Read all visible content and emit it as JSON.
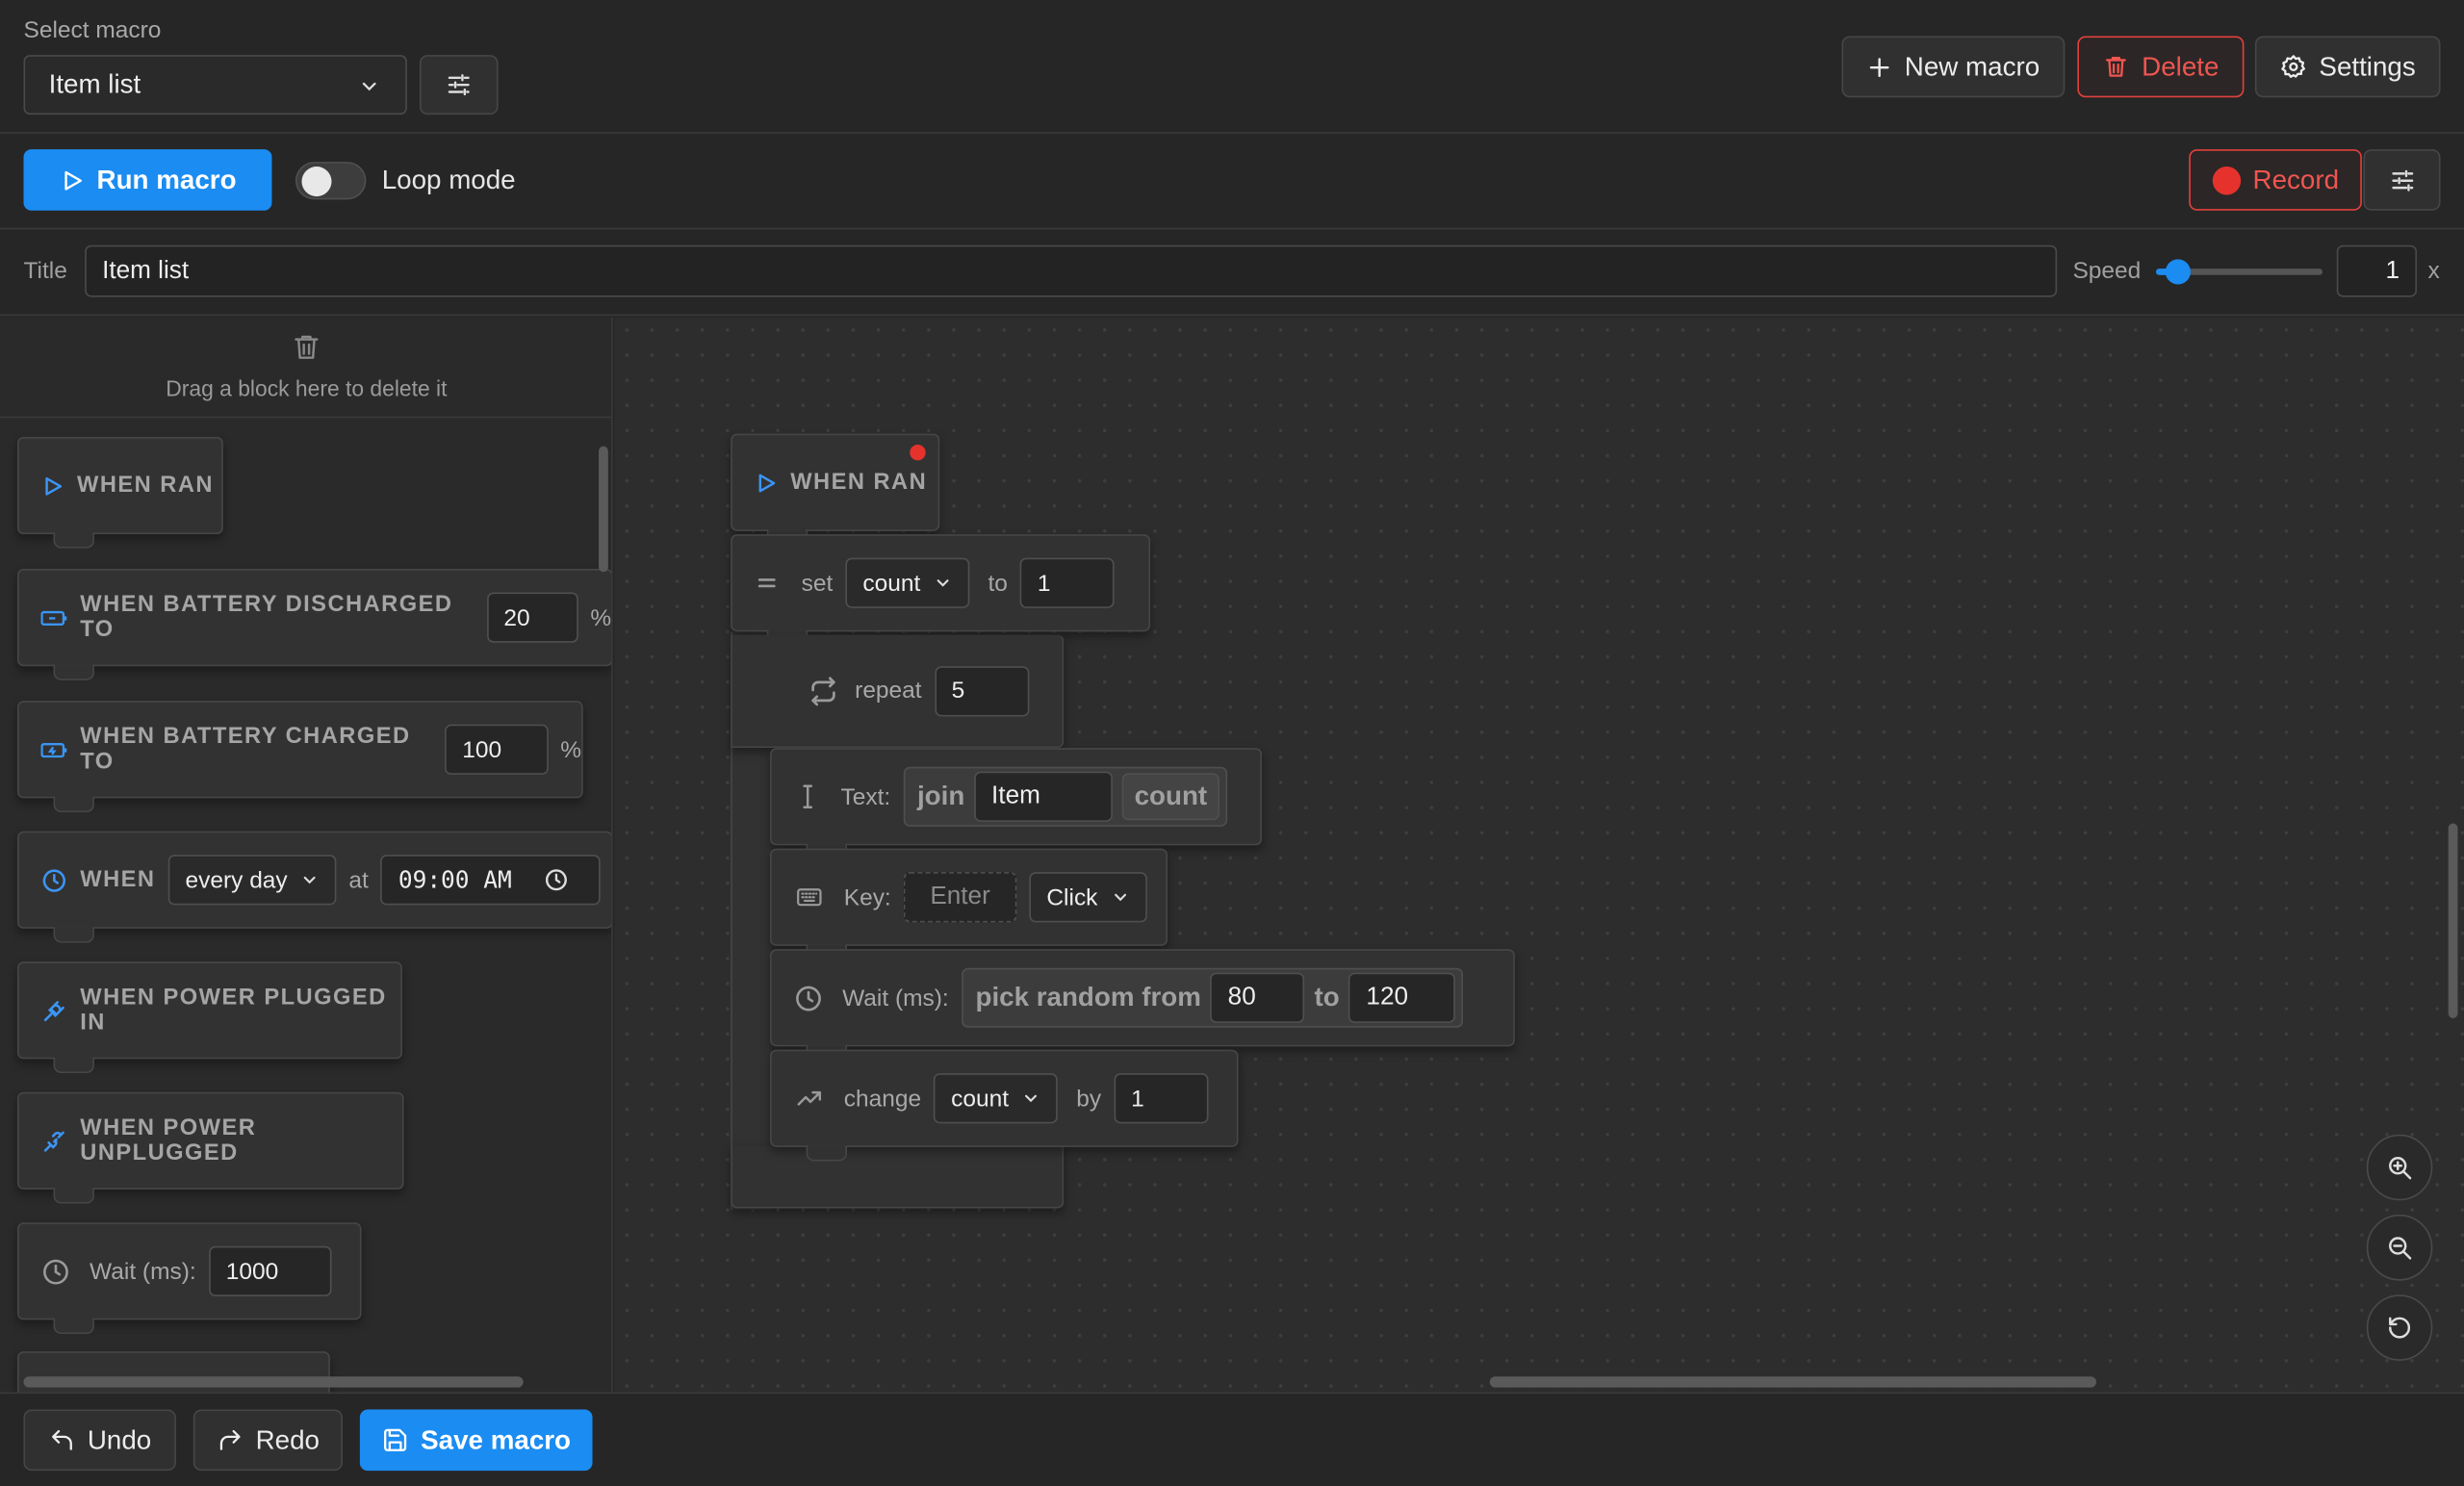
{
  "header": {
    "select_label": "Select macro",
    "selected_macro": "Item list",
    "new_macro": "New macro",
    "delete": "Delete",
    "settings": "Settings"
  },
  "toolbar": {
    "run": "Run macro",
    "loop_mode": "Loop mode",
    "loop_enabled": false,
    "record": "Record"
  },
  "titlebar": {
    "title_label": "Title",
    "title_value": "Item list",
    "speed_label": "Speed",
    "speed_value": "1",
    "speed_unit": "x",
    "speed_slider_fraction": 0.1
  },
  "sidebar": {
    "trash_hint": "Drag a block here to delete it",
    "blocks": {
      "when_ran": "WHEN RAN",
      "battery_discharged": "WHEN BATTERY DISCHARGED TO",
      "battery_discharged_value": "20",
      "battery_charged": "WHEN BATTERY CHARGED TO",
      "battery_charged_value": "100",
      "percent": "%",
      "when": "WHEN",
      "when_schedule": "every day",
      "at": "at",
      "time": "09:00 AM",
      "power_plugged": "WHEN POWER PLUGGED IN",
      "power_unplugged": "WHEN POWER UNPLUGGED",
      "wait_label": "Wait (ms):",
      "wait_value": "1000"
    }
  },
  "workspace": {
    "when_ran": "WHEN RAN",
    "set": "set",
    "set_var": "count",
    "to": "to",
    "set_value": "1",
    "repeat": "repeat",
    "repeat_value": "5",
    "text_label": "Text:",
    "join": "join",
    "join_item": "Item",
    "join_var": "count",
    "key_label": "Key:",
    "key_placeholder": "Enter",
    "key_action": "Click",
    "wait_label": "Wait (ms):",
    "pick_random": "pick random from",
    "random_from": "80",
    "random_to_label": "to",
    "random_to": "120",
    "change": "change",
    "change_var": "count",
    "by": "by",
    "change_value": "1"
  },
  "footer": {
    "undo": "Undo",
    "redo": "Redo",
    "save": "Save macro"
  },
  "colors": {
    "accent": "#1b8cf2",
    "danger": "#e0413d",
    "background": "#262626"
  }
}
